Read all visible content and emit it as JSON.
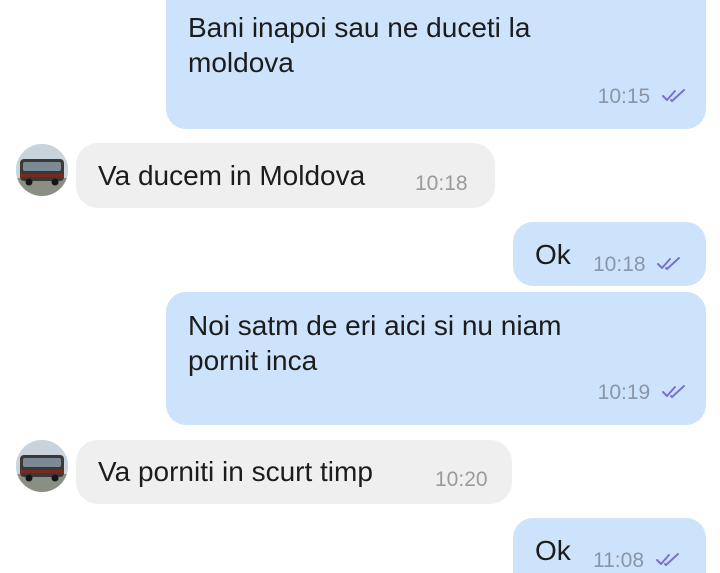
{
  "messages": [
    {
      "direction": "outgoing",
      "text": "Bani inapoi sau ne duceti la\nmoldova",
      "time": "10:15"
    },
    {
      "direction": "incoming",
      "text": "Va ducem in Moldova",
      "time": "10:18"
    },
    {
      "direction": "outgoing",
      "text": "Ok",
      "time": "10:18"
    },
    {
      "direction": "outgoing",
      "text": "Noi satm de eri aici si nu niam\npornit inca",
      "time": "10:19"
    },
    {
      "direction": "incoming",
      "text": "Va porniti in scurt timp",
      "time": "10:20"
    },
    {
      "direction": "outgoing",
      "text": "Ok",
      "time": "11:08"
    }
  ],
  "contact": {
    "avatar_icon": "bus-avatar-icon"
  },
  "colors": {
    "outgoing_bubble": "#cce3fb",
    "incoming_bubble": "#efefef",
    "read_ticks": "#7b6fd0"
  }
}
